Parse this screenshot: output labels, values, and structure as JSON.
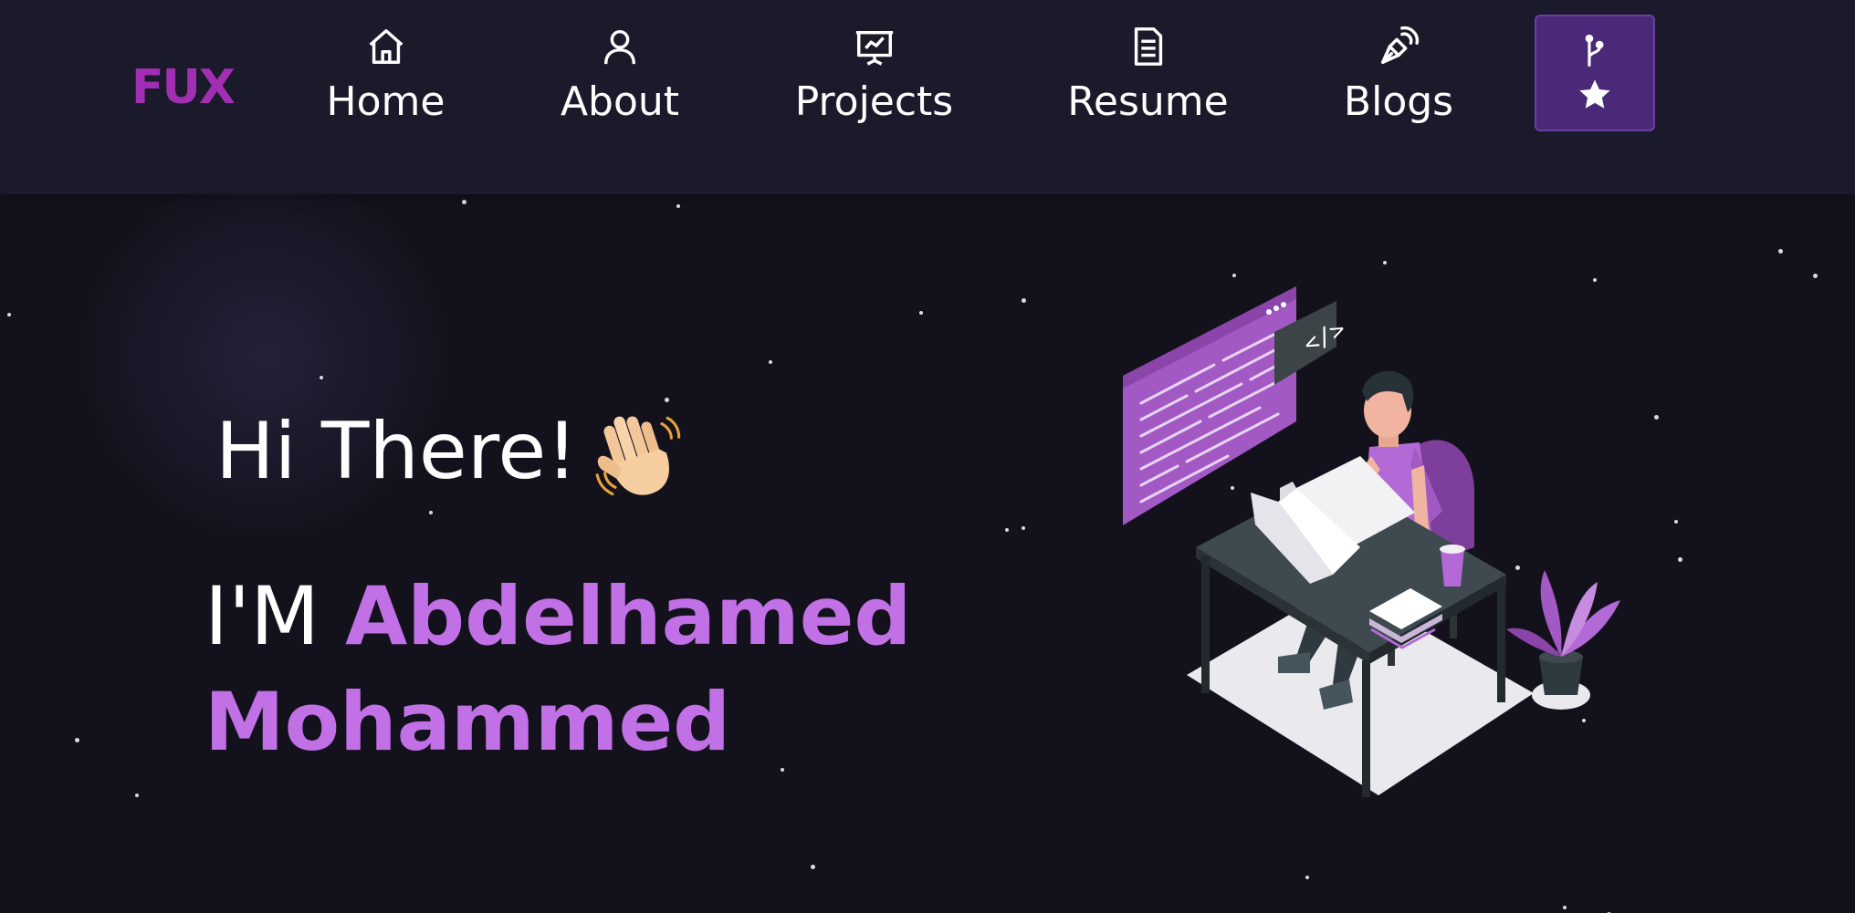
{
  "logo": {
    "text": "FUX"
  },
  "nav": {
    "items": [
      {
        "label": "Home",
        "icon": "home-icon"
      },
      {
        "label": "About",
        "icon": "user-icon"
      },
      {
        "label": "Projects",
        "icon": "presentation-chart-icon"
      },
      {
        "label": "Resume",
        "icon": "document-icon"
      },
      {
        "label": "Blogs",
        "icon": "pen-nib-icon"
      }
    ],
    "github_button": {
      "icons": [
        "git-fork-icon",
        "star-icon"
      ]
    }
  },
  "hero": {
    "greeting": "Hi There!",
    "greeting_emoji": "waving-hand-icon",
    "intro_prefix": "I'M",
    "name": "Abdelhamed Mohammed",
    "illustration": "developer-at-desk-illustration"
  },
  "colors": {
    "background": "#13121c",
    "navbar": "#1b1a2b",
    "accent": "#c170e6",
    "logo": "#a22fb3",
    "button": "#4a2a78"
  }
}
